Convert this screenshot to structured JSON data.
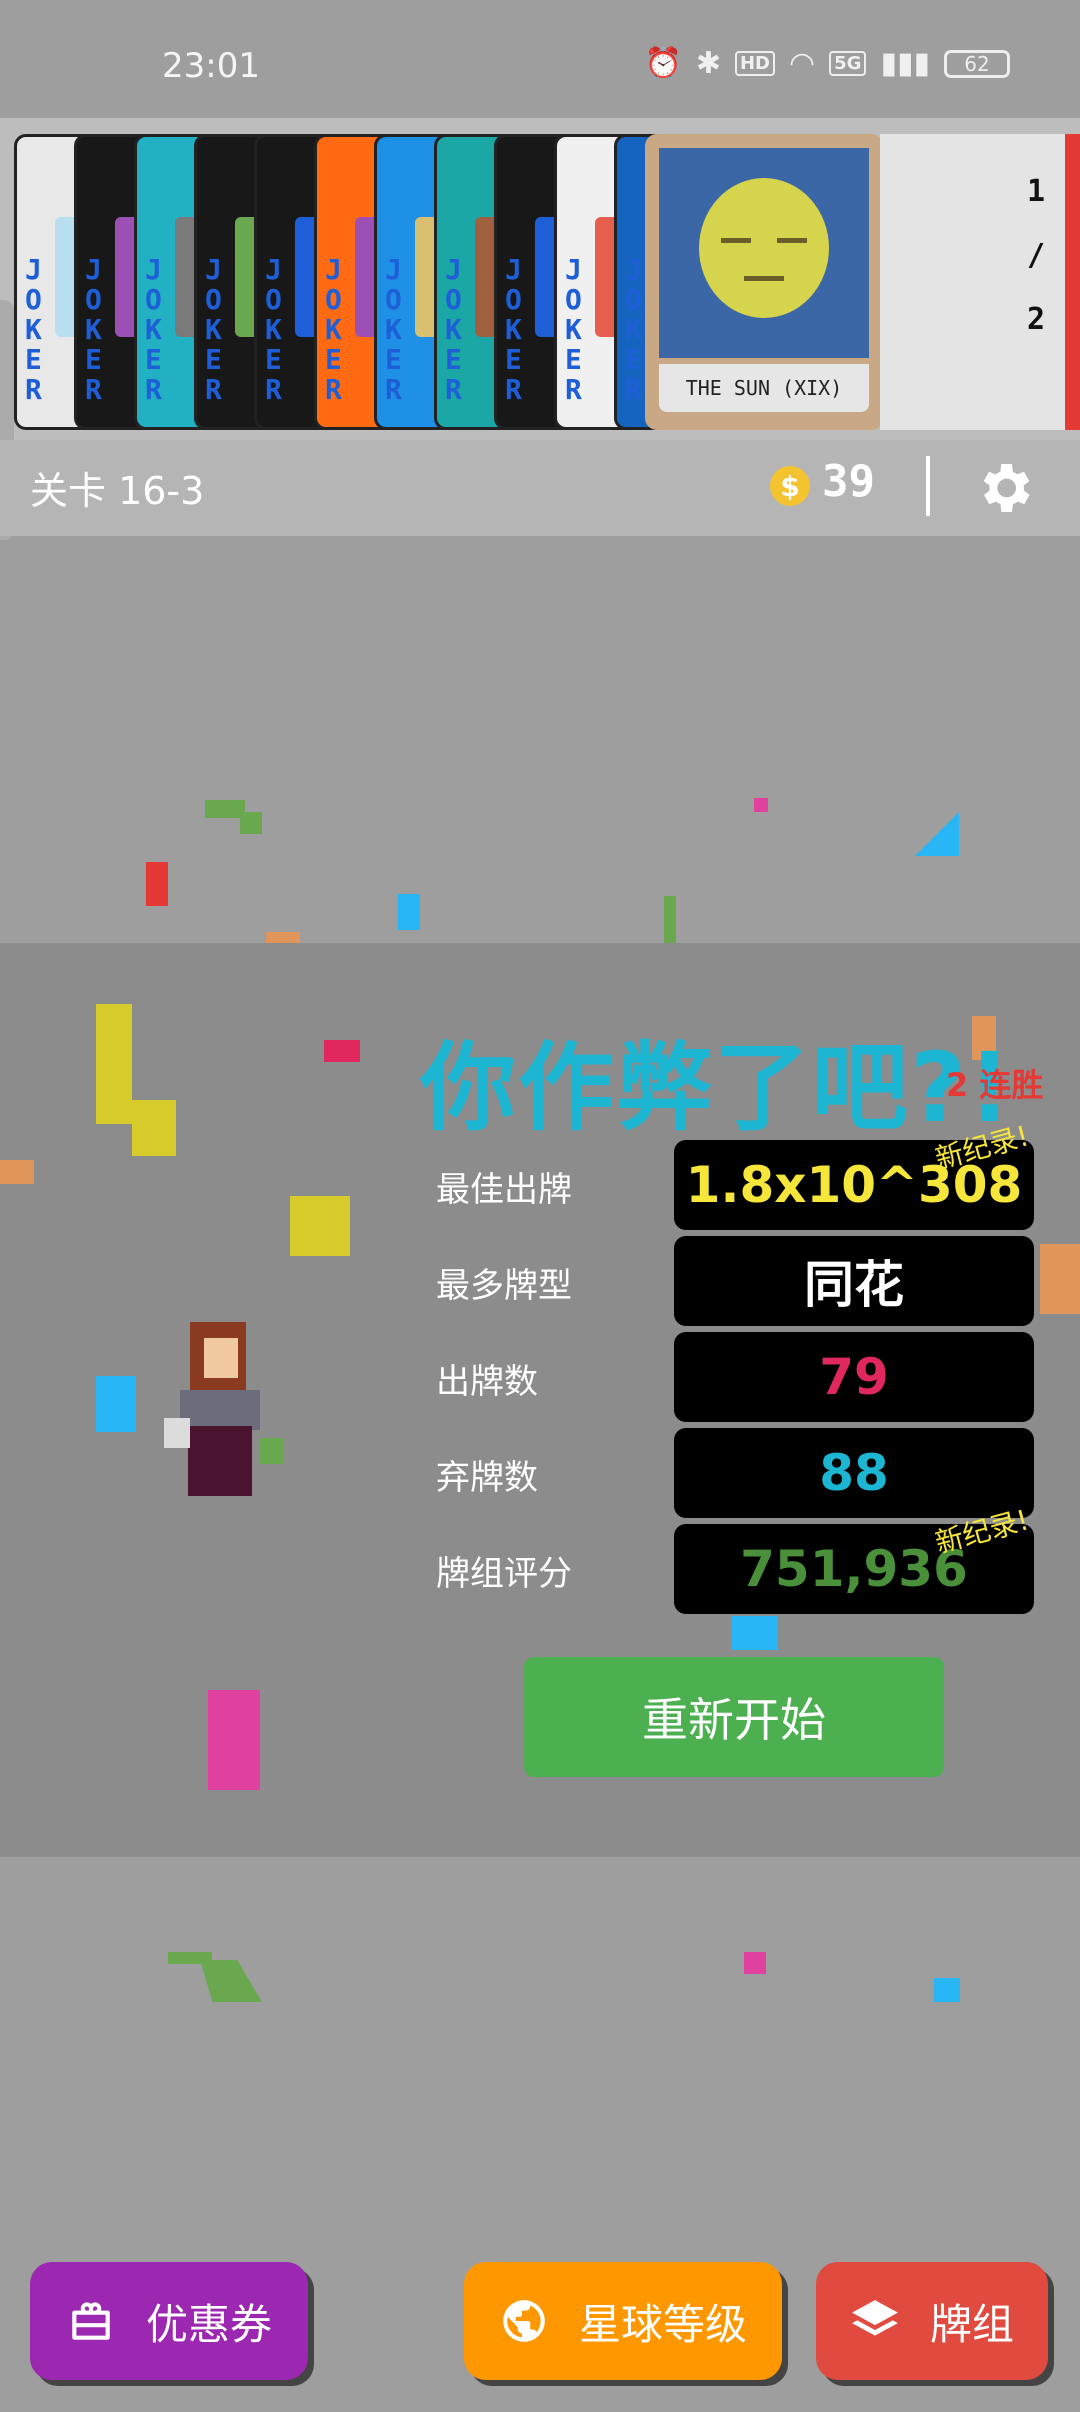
{
  "status": {
    "time": "23:01",
    "hd": "HD",
    "network": "5G",
    "battery": "62"
  },
  "jokers": [
    {
      "text": "JOKER",
      "bg": "#e8e8e8",
      "art": "#b8e0f0"
    },
    {
      "text": "JOKER",
      "bg": "#181818",
      "art": "#9c4fb5"
    },
    {
      "text": "JOKER",
      "bg": "#21b1c2",
      "art": "#7a7a7a"
    },
    {
      "text": "JOKER",
      "bg": "#181818",
      "art": "#6aa84f"
    },
    {
      "text": "JOKER",
      "bg": "#181818",
      "art": "#1e5fd8"
    },
    {
      "text": "JOKER",
      "bg": "#ff6a13",
      "art": "#9c4fb5"
    },
    {
      "text": "JOKER",
      "bg": "#1e90e6",
      "art": "#d9c070"
    },
    {
      "text": "JOKER",
      "bg": "#1aa7a6",
      "art": "#a06040"
    },
    {
      "text": "JOKER",
      "bg": "#181818",
      "art": "#1e5fd8"
    },
    {
      "text": "JOKER",
      "bg": "#f0f0f0",
      "art": "#e55e4e"
    },
    {
      "text": "JOKER",
      "bg": "#1565c0",
      "art": "#e0e0e0"
    }
  ],
  "tarot": {
    "label": "THE SUN (XIX)",
    "count_top": "1",
    "count_sep": "/",
    "count_bottom": "2"
  },
  "info": {
    "stage": "关卡 16-3",
    "coin_symbol": "$",
    "coins": "39"
  },
  "result": {
    "title": "你作弊了吧?!",
    "streak": "2 连胜",
    "rows": [
      {
        "label": "最佳出牌",
        "value": "1.8x10^308",
        "color": "#f6e53a",
        "new_record": "新纪录!"
      },
      {
        "label": "最多牌型",
        "value": "同花",
        "color": "#ffffff"
      },
      {
        "label": "出牌数",
        "value": "79",
        "color": "#e0285e"
      },
      {
        "label": "弃牌数",
        "value": "88",
        "color": "#1db6d2"
      },
      {
        "label": "牌组评分",
        "value": "751,936",
        "color": "#4a8f3a",
        "new_record": "新纪录!"
      }
    ],
    "restart": "重新开始"
  },
  "bottom": {
    "coupon": "优惠券",
    "planet": "星球等级",
    "deck": "牌组"
  },
  "colors": {
    "coupon": "#9c27b0",
    "planet": "#ff9800",
    "deck": "#e04a3f"
  }
}
